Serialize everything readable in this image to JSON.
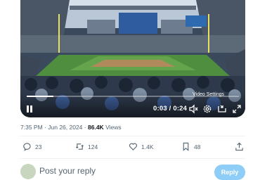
{
  "video": {
    "tooltip": "Video Settings",
    "current_time": "0:03",
    "duration": "0:24",
    "time_display": "0:03 / 0:24",
    "progress": 0.125,
    "icons": [
      "pause-icon",
      "volume-icon",
      "gear-icon",
      "dock-icon",
      "fullscreen-icon"
    ]
  },
  "tweet_meta": {
    "time": "7:35 PM",
    "separator": "·",
    "date": "Jun 26, 2024",
    "views_count": "86.4K",
    "views_label": "Views"
  },
  "actions": {
    "replies": "23",
    "reposts": "124",
    "likes": "1.4K",
    "bookmarks": "48"
  },
  "reply": {
    "placeholder": "Post your reply",
    "button_label": "Reply"
  },
  "colors": {
    "accent": "#1d9bf0",
    "reply_button_disabled": "#8ecdf8",
    "muted_text": "#536471"
  }
}
